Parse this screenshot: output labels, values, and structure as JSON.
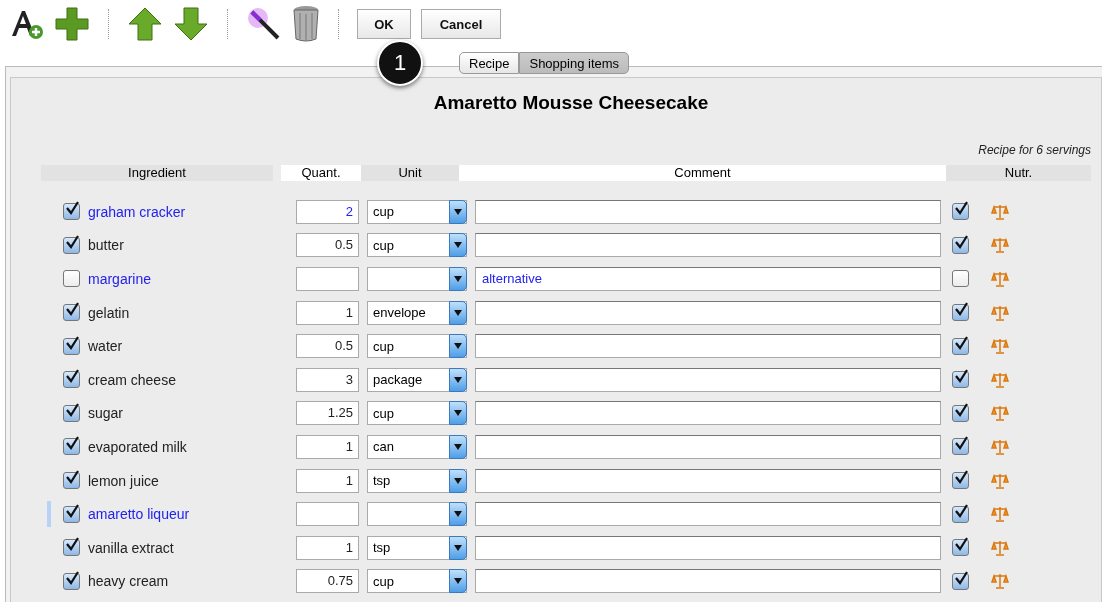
{
  "toolbar": {
    "buttons": [
      {
        "label": "OK"
      },
      {
        "label": "Cancel"
      }
    ]
  },
  "callout": {
    "label": "1"
  },
  "tabs": [
    {
      "label": "Recipe",
      "selected": false
    },
    {
      "label": "Shopping items",
      "selected": true
    }
  ],
  "recipe": {
    "title": "Amaretto Mousse Cheesecake",
    "servings": "Recipe for 6 servings"
  },
  "table": {
    "columns": [
      "Ingredient",
      "Quant.",
      "Unit",
      "Comment",
      "Nutr."
    ],
    "rows": [
      {
        "name": "graham cracker",
        "quantity": "2",
        "unit": "cup",
        "comment": "",
        "checked": true,
        "nutrition_checked": true,
        "linked": true,
        "selected": false
      },
      {
        "name": "butter",
        "quantity": "0.5",
        "unit": "cup",
        "comment": "",
        "checked": true,
        "nutrition_checked": true,
        "linked": false,
        "selected": false
      },
      {
        "name": "margarine",
        "quantity": "",
        "unit": "",
        "comment": "alternative",
        "checked": false,
        "nutrition_checked": false,
        "linked": true,
        "selected": false
      },
      {
        "name": "gelatin",
        "quantity": "1",
        "unit": "envelope",
        "comment": "",
        "checked": true,
        "nutrition_checked": true,
        "linked": false,
        "selected": false
      },
      {
        "name": "water",
        "quantity": "0.5",
        "unit": "cup",
        "comment": "",
        "checked": true,
        "nutrition_checked": true,
        "linked": false,
        "selected": false
      },
      {
        "name": "cream cheese",
        "quantity": "3",
        "unit": "package",
        "comment": "",
        "checked": true,
        "nutrition_checked": true,
        "linked": false,
        "selected": false
      },
      {
        "name": "sugar",
        "quantity": "1.25",
        "unit": "cup",
        "comment": "",
        "checked": true,
        "nutrition_checked": true,
        "linked": false,
        "selected": false
      },
      {
        "name": "evaporated milk",
        "quantity": "1",
        "unit": "can",
        "comment": "",
        "checked": true,
        "nutrition_checked": true,
        "linked": false,
        "selected": false
      },
      {
        "name": "lemon juice",
        "quantity": "1",
        "unit": "tsp",
        "comment": "",
        "checked": true,
        "nutrition_checked": true,
        "linked": false,
        "selected": false
      },
      {
        "name": "amaretto liqueur",
        "quantity": "",
        "unit": "",
        "comment": "",
        "checked": true,
        "nutrition_checked": true,
        "linked": true,
        "selected": true
      },
      {
        "name": "vanilla extract",
        "quantity": "1",
        "unit": "tsp",
        "comment": "",
        "checked": true,
        "nutrition_checked": true,
        "linked": false,
        "selected": false
      },
      {
        "name": "heavy cream",
        "quantity": "0.75",
        "unit": "cup",
        "comment": "",
        "checked": true,
        "nutrition_checked": true,
        "linked": false,
        "selected": false
      }
    ]
  }
}
